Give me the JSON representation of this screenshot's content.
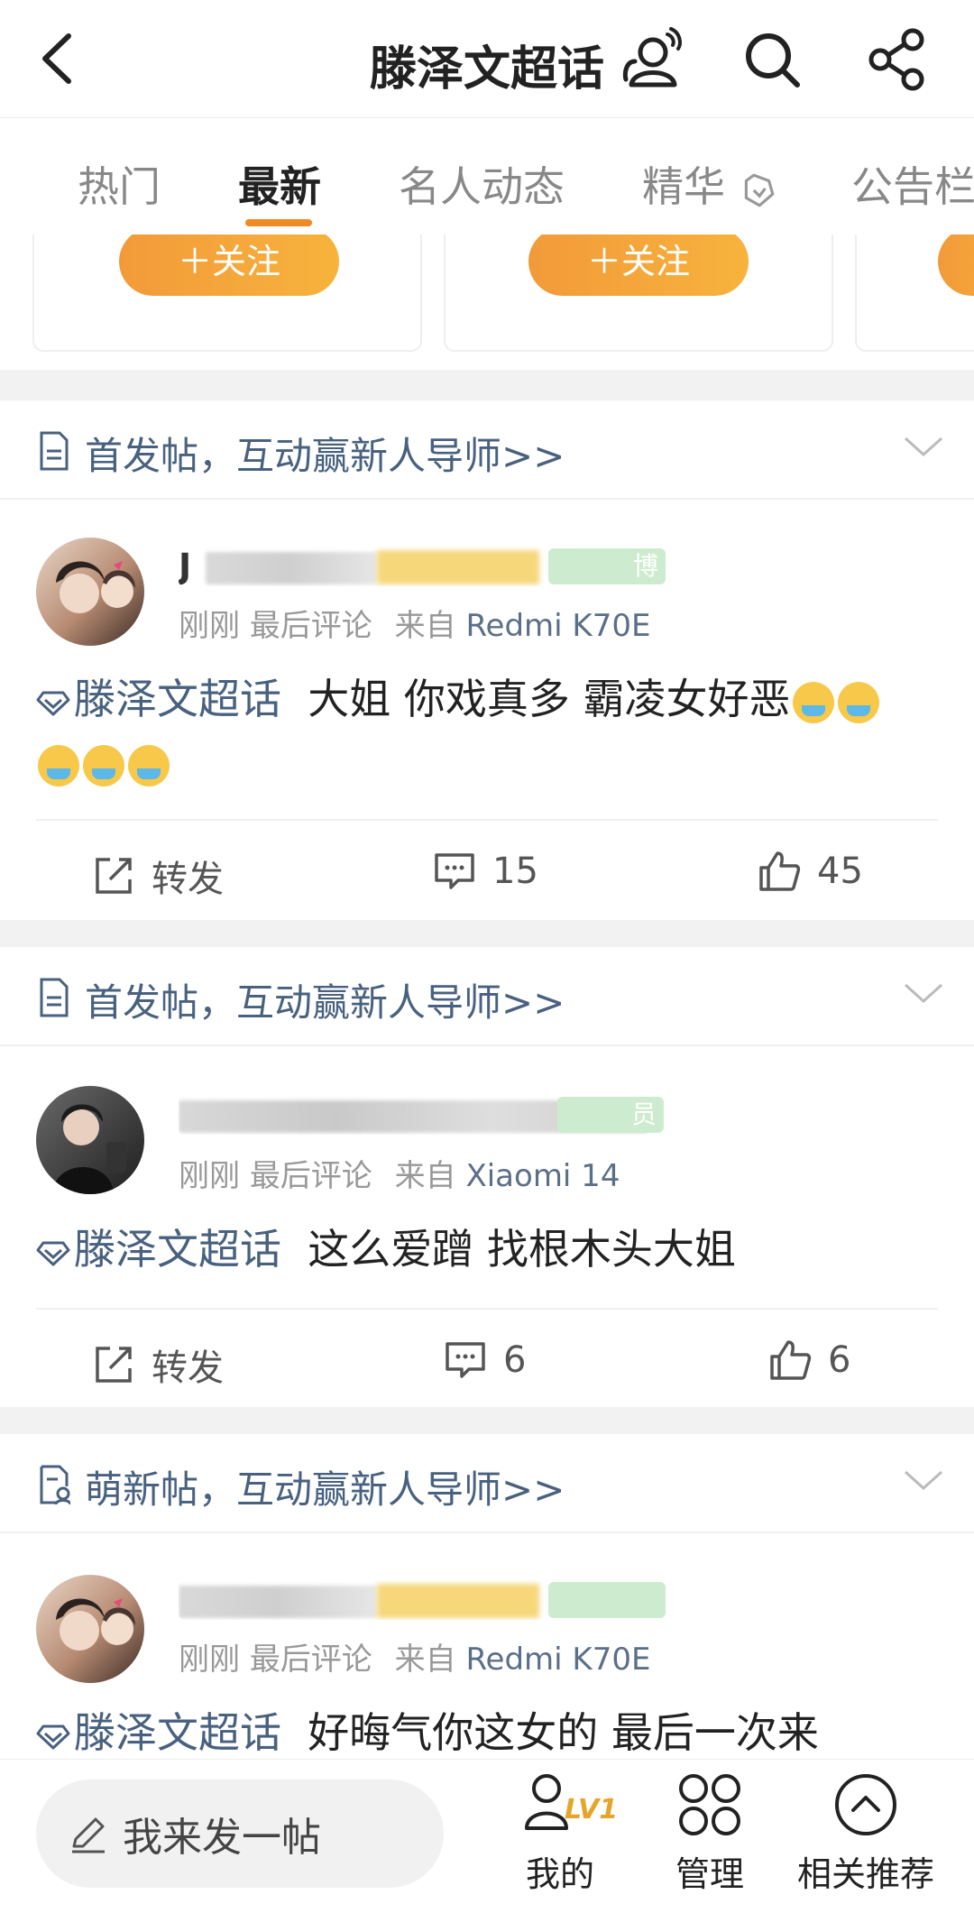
{
  "header": {
    "title": "滕泽文超话"
  },
  "tabs": [
    {
      "label": "热门"
    },
    {
      "label": "最新"
    },
    {
      "label": "名人动态"
    },
    {
      "label": "精华"
    },
    {
      "label": "公告栏"
    }
  ],
  "cards": {
    "follow_label": "＋关注"
  },
  "sections": [
    {
      "header_text": "首发帖，互动赢新人导师>>",
      "post": {
        "username_visible": "J",
        "badge_text": "博",
        "time": "刚刚",
        "last_comment": "最后评论",
        "from": "来自",
        "device": "Redmi K70E",
        "topic": "滕泽文超话",
        "text": "大姐 你戏真多 霸凌女好恶",
        "repost_label": "转发",
        "comments": "15",
        "likes": "45"
      }
    },
    {
      "header_text": "首发帖，互动赢新人导师>>",
      "post": {
        "badge_text": "员",
        "time": "刚刚",
        "last_comment": "最后评论",
        "from": "来自",
        "device": "Xiaomi 14",
        "topic": "滕泽文超话",
        "text": "这么爱蹭 找根木头大姐",
        "repost_label": "转发",
        "comments": "6",
        "likes": "6"
      }
    },
    {
      "header_text": "萌新帖，互动赢新人导师>>",
      "post": {
        "time": "刚刚",
        "last_comment": "最后评论",
        "from": "来自",
        "device": "Redmi K70E",
        "topic": "滕泽文超话",
        "text": "好晦气你这女的 最后一次来"
      }
    }
  ],
  "bottom": {
    "compose_label": "我来发一帖",
    "level_badge": "LV1",
    "mine_label": "我的",
    "manage_label": "管理",
    "recommend_label": "相关推荐"
  },
  "colors": {
    "accent": "#f08a24",
    "link": "#48617f"
  }
}
